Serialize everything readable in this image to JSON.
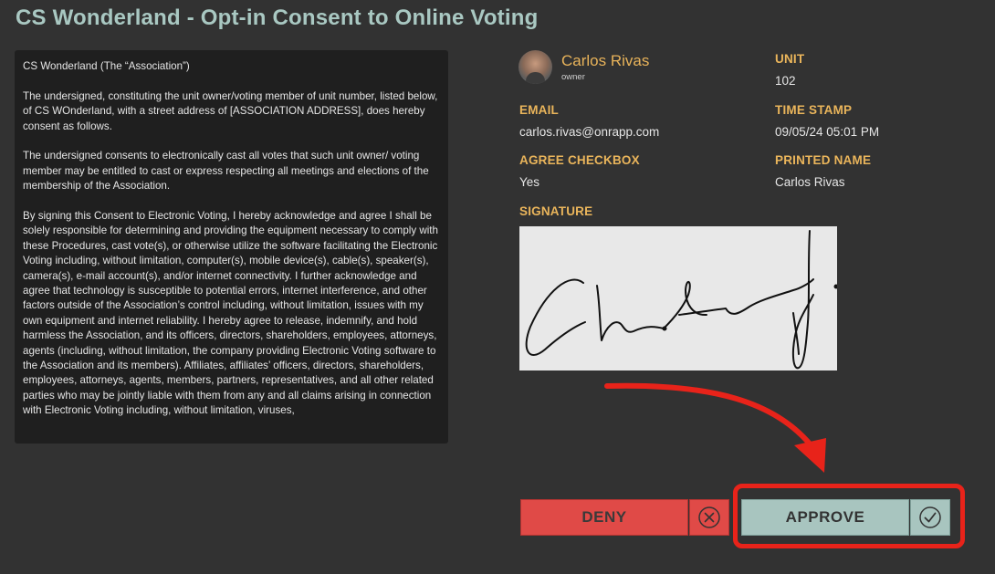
{
  "header": {
    "title": "CS Wonderland - Opt-in Consent to Online Voting"
  },
  "document": {
    "paragraphs": [
      "CS Wonderland (The “Association”)",
      "The undersigned, constituting the unit owner/voting member of unit number, listed below, of CS WOnderland, with a street address of [ASSOCIATION ADDRESS], does hereby consent as follows.",
      "The undersigned consents to electronically cast all votes that such unit owner/ voting member may be entitled to cast or express respecting all meetings and elections of the membership of the Association.",
      "By signing this Consent to Electronic Voting, I hereby acknowledge and agree I shall be solely responsible for determining and providing the equipment necessary to comply with these Procedures, cast vote(s), or otherwise utilize the software facilitating the Electronic Voting including, without limitation, computer(s), mobile device(s), cable(s), speaker(s), camera(s), e-mail account(s), and/or internet connectivity. I further acknowledge and agree that technology is susceptible to potential errors, internet interference, and other factors outside of the Association’s control including, without limitation, issues with my own equipment and internet reliability. I hereby agree to release, indemnify, and hold harmless the Association, and its officers, directors, shareholders, employees, attorneys, agents (including, without limitation, the company providing Electronic Voting software to the Association and its members). Affiliates, affiliates’ officers, directors, shareholders, employees, attorneys, agents, members, partners, representatives, and all other related parties who may be jointly liable with them from any and all claims arising in connection with Electronic Voting including, without limitation, viruses,"
    ]
  },
  "profile": {
    "name": "Carlos Rivas",
    "role": "owner",
    "avatar_icon": "avatar-photo"
  },
  "fields": {
    "unit_label": "UNIT",
    "unit_value": "102",
    "email_label": "EMAIL",
    "email_value": "carlos.rivas@onrapp.com",
    "timestamp_label": "TIME STAMP",
    "timestamp_value": "09/05/24 05:01 PM",
    "agree_label": "AGREE CHECKBOX",
    "agree_value": "Yes",
    "printed_name_label": "PRINTED NAME",
    "printed_name_value": "Carlos Rivas",
    "signature_label": "SIGNATURE"
  },
  "actions": {
    "deny_label": "DENY",
    "deny_icon": "circle-x-icon",
    "approve_label": "APPROVE",
    "approve_icon": "circle-check-icon"
  },
  "colors": {
    "background": "#323232",
    "title": "#a9c8c2",
    "accent_label": "#eab55b",
    "deny": "#e04a47",
    "approve": "#a8c5bf",
    "annotation": "#e8231a"
  }
}
